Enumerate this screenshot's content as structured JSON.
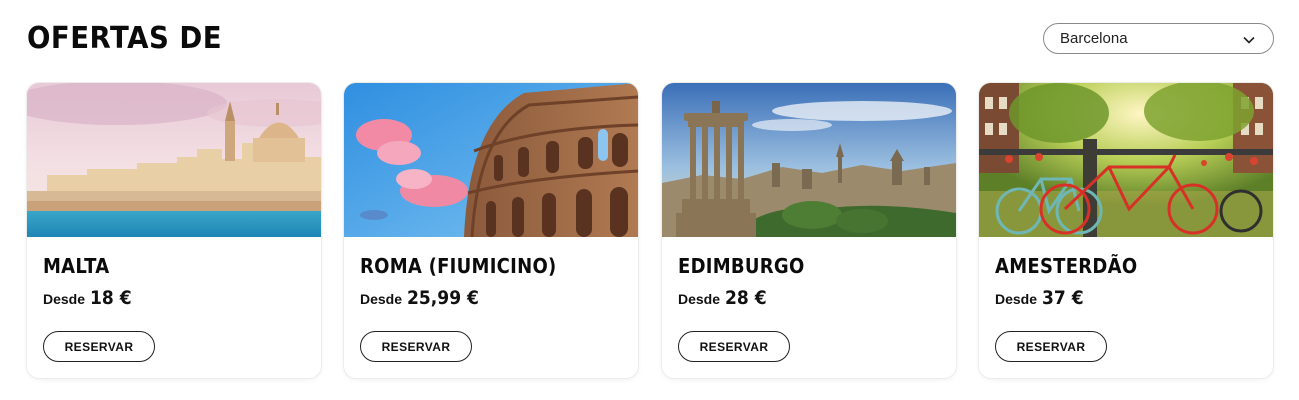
{
  "header": {
    "title": "OFERTAS DE",
    "origin_select": {
      "selected": "Barcelona",
      "icon": "chevron-down-icon"
    }
  },
  "cards": [
    {
      "destination": "MALTA",
      "desde": "Desde",
      "price": "18 €",
      "button": "RESERVAR",
      "image": "valletta-skyline-photo"
    },
    {
      "destination": "ROMA (FIUMICINO)",
      "desde": "Desde",
      "price": "25,99 €",
      "button": "RESERVAR",
      "image": "colosseum-photo"
    },
    {
      "destination": "EDIMBURGO",
      "desde": "Desde",
      "price": "28 €",
      "button": "RESERVAR",
      "image": "edinburgh-calton-hill-photo"
    },
    {
      "destination": "AMESTERDÃO",
      "desde": "Desde",
      "price": "37 €",
      "button": "RESERVAR",
      "image": "amsterdam-bicycles-photo"
    }
  ]
}
